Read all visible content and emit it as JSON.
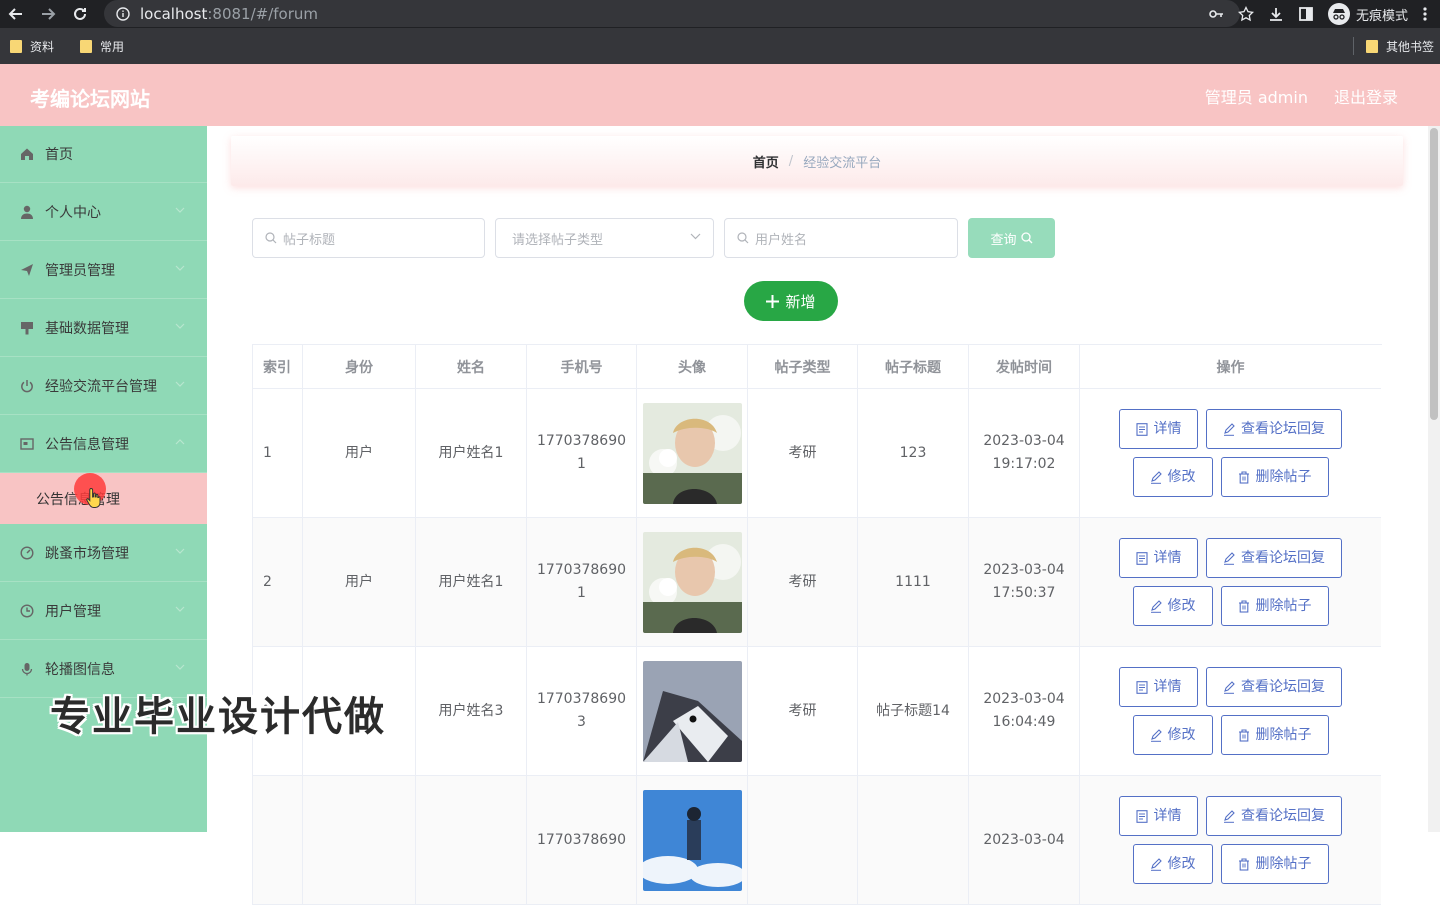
{
  "browser": {
    "url_host": "localhost",
    "url_rest": ":8081/#/forum",
    "incognito_label": "无痕模式",
    "bookmarks": [
      "资料",
      "常用"
    ],
    "other_bookmarks": "其他书签"
  },
  "header": {
    "title": "考编论坛网站",
    "admin_label": "管理员 admin",
    "logout_label": "退出登录"
  },
  "sidebar": {
    "items": [
      {
        "label": "首页",
        "icon": "home-icon"
      },
      {
        "label": "个人中心",
        "icon": "user-icon"
      },
      {
        "label": "管理员管理",
        "icon": "send-icon"
      },
      {
        "label": "基础数据管理",
        "icon": "brush-icon"
      },
      {
        "label": "经验交流平台管理",
        "icon": "power-icon"
      },
      {
        "label": "公告信息管理",
        "icon": "notice-icon"
      },
      {
        "label": "跳蚤市场管理",
        "icon": "dashboard-icon"
      },
      {
        "label": "用户管理",
        "icon": "clock-icon"
      },
      {
        "label": "轮播图信息",
        "icon": "mic-icon"
      }
    ],
    "submenu_label": "公告信息管理"
  },
  "breadcrumb": {
    "home": "首页",
    "separator": "/",
    "current": "经验交流平台"
  },
  "search": {
    "title_placeholder": "帖子标题",
    "type_placeholder": "请选择帖子类型",
    "user_placeholder": "用户姓名",
    "query_label": "查询",
    "add_label": "新增"
  },
  "table": {
    "headers": [
      "索引",
      "身份",
      "姓名",
      "手机号",
      "头像",
      "帖子类型",
      "帖子标题",
      "发帖时间",
      "操作"
    ],
    "rows": [
      {
        "index": "1",
        "role": "用户",
        "name": "用户姓名1",
        "phone1": "1770378690",
        "phone2": "1",
        "type": "考研",
        "title": "123",
        "date": "2023-03-04",
        "time": "19:17:02",
        "avatar": "portrait"
      },
      {
        "index": "2",
        "role": "用户",
        "name": "用户姓名1",
        "phone1": "1770378690",
        "phone2": "1",
        "type": "考研",
        "title": "1111",
        "date": "2023-03-04",
        "time": "17:50:37",
        "avatar": "portrait"
      },
      {
        "index": "3",
        "role": "用户",
        "name": "用户姓名3",
        "phone1": "1770378690",
        "phone2": "3",
        "type": "考研",
        "title": "帖子标题14",
        "date": "2023-03-04",
        "time": "16:04:49",
        "avatar": "husky"
      },
      {
        "index": "",
        "role": "",
        "name": "",
        "phone1": "1770378690",
        "phone2": "",
        "type": "",
        "title": "",
        "date": "2023-03-04",
        "time": "",
        "avatar": "sky"
      }
    ],
    "actions": {
      "detail": "详情",
      "view_replies": "查看论坛回复",
      "edit": "修改",
      "delete": "删除帖子"
    }
  },
  "watermark": "专业毕业设计代做",
  "colors": {
    "header_bg": "#f8c4c4",
    "sidebar_bg": "#8fd9b6",
    "add_button": "#28a745",
    "action_border": "#5470c6"
  }
}
